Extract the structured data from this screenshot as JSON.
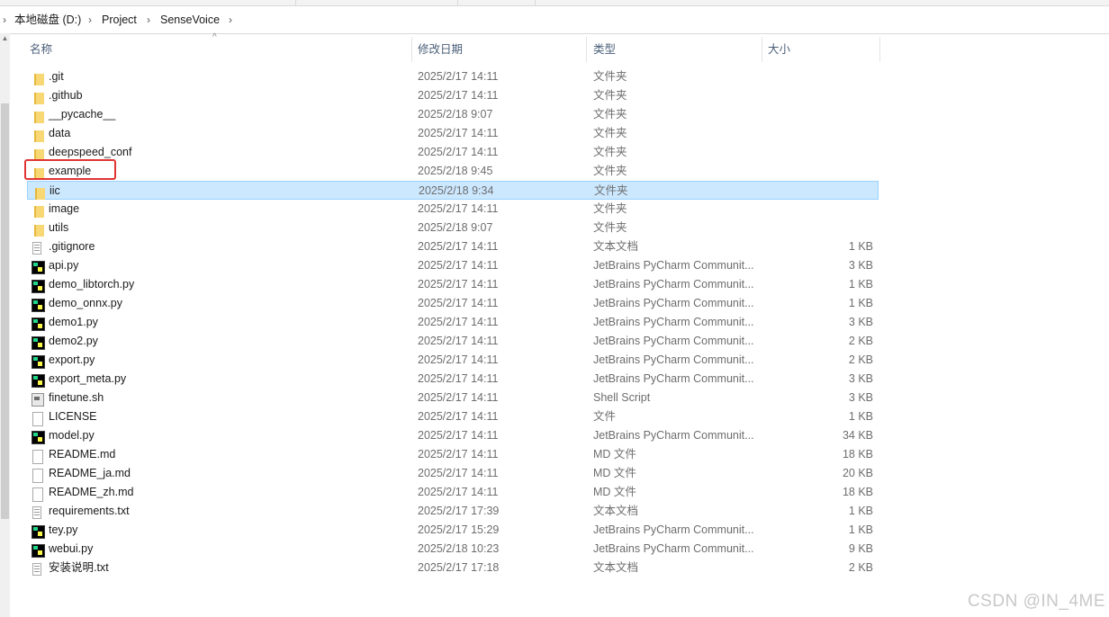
{
  "breadcrumb": [
    "本地磁盘 (D:)",
    "Project",
    "SenseVoice"
  ],
  "columns": {
    "name": "名称",
    "date": "修改日期",
    "type": "类型",
    "size": "大小"
  },
  "files": [
    {
      "name": ".git",
      "date": "2025/2/17 14:11",
      "type": "文件夹",
      "size": "",
      "icon": "folder-icon"
    },
    {
      "name": ".github",
      "date": "2025/2/17 14:11",
      "type": "文件夹",
      "size": "",
      "icon": "folder-icon"
    },
    {
      "name": "__pycache__",
      "date": "2025/2/18 9:07",
      "type": "文件夹",
      "size": "",
      "icon": "folder-icon"
    },
    {
      "name": "data",
      "date": "2025/2/17 14:11",
      "type": "文件夹",
      "size": "",
      "icon": "folder-icon"
    },
    {
      "name": "deepspeed_conf",
      "date": "2025/2/17 14:11",
      "type": "文件夹",
      "size": "",
      "icon": "folder-icon"
    },
    {
      "name": "example",
      "date": "2025/2/18 9:45",
      "type": "文件夹",
      "size": "",
      "icon": "folder-icon"
    },
    {
      "name": "iic",
      "date": "2025/2/18 9:34",
      "type": "文件夹",
      "size": "",
      "icon": "folder-icon",
      "selected": true
    },
    {
      "name": "image",
      "date": "2025/2/17 14:11",
      "type": "文件夹",
      "size": "",
      "icon": "folder-icon"
    },
    {
      "name": "utils",
      "date": "2025/2/18 9:07",
      "type": "文件夹",
      "size": "",
      "icon": "folder-icon"
    },
    {
      "name": ".gitignore",
      "date": "2025/2/17 14:11",
      "type": "文本文档",
      "size": "1 KB",
      "icon": "text-file-icon"
    },
    {
      "name": "api.py",
      "date": "2025/2/17 14:11",
      "type": "JetBrains PyCharm Communit...",
      "size": "3 KB",
      "icon": "pycharm-file-icon"
    },
    {
      "name": "demo_libtorch.py",
      "date": "2025/2/17 14:11",
      "type": "JetBrains PyCharm Communit...",
      "size": "1 KB",
      "icon": "pycharm-file-icon"
    },
    {
      "name": "demo_onnx.py",
      "date": "2025/2/17 14:11",
      "type": "JetBrains PyCharm Communit...",
      "size": "1 KB",
      "icon": "pycharm-file-icon"
    },
    {
      "name": "demo1.py",
      "date": "2025/2/17 14:11",
      "type": "JetBrains PyCharm Communit...",
      "size": "3 KB",
      "icon": "pycharm-file-icon"
    },
    {
      "name": "demo2.py",
      "date": "2025/2/17 14:11",
      "type": "JetBrains PyCharm Communit...",
      "size": "2 KB",
      "icon": "pycharm-file-icon"
    },
    {
      "name": "export.py",
      "date": "2025/2/17 14:11",
      "type": "JetBrains PyCharm Communit...",
      "size": "2 KB",
      "icon": "pycharm-file-icon"
    },
    {
      "name": "export_meta.py",
      "date": "2025/2/17 14:11",
      "type": "JetBrains PyCharm Communit...",
      "size": "3 KB",
      "icon": "pycharm-file-icon"
    },
    {
      "name": "finetune.sh",
      "date": "2025/2/17 14:11",
      "type": "Shell Script",
      "size": "3 KB",
      "icon": "shell-script-icon"
    },
    {
      "name": "LICENSE",
      "date": "2025/2/17 14:11",
      "type": "文件",
      "size": "1 KB",
      "icon": "blank-file-icon"
    },
    {
      "name": "model.py",
      "date": "2025/2/17 14:11",
      "type": "JetBrains PyCharm Communit...",
      "size": "34 KB",
      "icon": "pycharm-file-icon"
    },
    {
      "name": "README.md",
      "date": "2025/2/17 14:11",
      "type": "MD 文件",
      "size": "18 KB",
      "icon": "blank-file-icon"
    },
    {
      "name": "README_ja.md",
      "date": "2025/2/17 14:11",
      "type": "MD 文件",
      "size": "20 KB",
      "icon": "blank-file-icon"
    },
    {
      "name": "README_zh.md",
      "date": "2025/2/17 14:11",
      "type": "MD 文件",
      "size": "18 KB",
      "icon": "blank-file-icon"
    },
    {
      "name": "requirements.txt",
      "date": "2025/2/17 17:39",
      "type": "文本文档",
      "size": "1 KB",
      "icon": "text-file-icon"
    },
    {
      "name": "tey.py",
      "date": "2025/2/17 15:29",
      "type": "JetBrains PyCharm Communit...",
      "size": "1 KB",
      "icon": "pycharm-file-icon"
    },
    {
      "name": "webui.py",
      "date": "2025/2/18 10:23",
      "type": "JetBrains PyCharm Communit...",
      "size": "9 KB",
      "icon": "pycharm-file-icon"
    },
    {
      "name": "安装说明.txt",
      "date": "2025/2/17 17:18",
      "type": "文本文档",
      "size": "2 KB",
      "icon": "text-file-icon"
    }
  ],
  "highlighted_item": "example",
  "watermark": "CSDN @IN_4ME",
  "colors": {
    "selection_bg": "#cce8ff",
    "selection_border": "#99d1ff",
    "highlight_box": "#e03434",
    "folder": "#f8d775"
  }
}
